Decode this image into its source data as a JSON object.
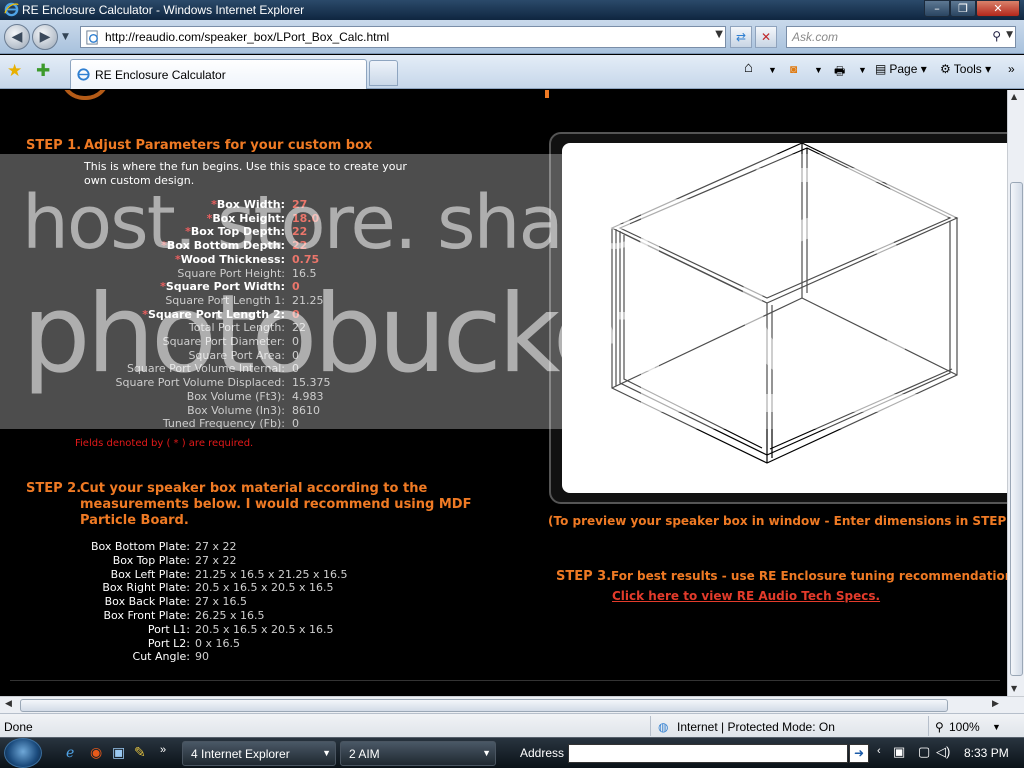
{
  "window": {
    "title": "RE Enclosure Calculator - Windows Internet Explorer",
    "minimize": "–",
    "maximize": "❐",
    "close": "✕"
  },
  "navigation": {
    "url": "http://reaudio.com/speaker_box/LPort_Box_Calc.html",
    "search_placeholder": "Ask.com"
  },
  "tabs": [
    {
      "label": "RE Enclosure Calculator"
    }
  ],
  "commands": {
    "page": "Page",
    "tools": "Tools"
  },
  "step1": {
    "number": "STEP 1.",
    "heading": "Adjust Parameters for your custom box",
    "intro_line1": "This is where the fun begins.  Use this space to create your",
    "intro_line2": "own custom design.",
    "params": [
      {
        "label": "Box Width:",
        "value": "27",
        "required": true
      },
      {
        "label": "Box Height:",
        "value": "18.0",
        "required": true
      },
      {
        "label": "Box Top Depth:",
        "value": "22",
        "required": true
      },
      {
        "label": "Box Bottom Depth:",
        "value": "22",
        "required": true
      },
      {
        "label": "Wood Thickness:",
        "value": "0.75",
        "required": true
      },
      {
        "label": "Square Port Height:",
        "value": "16.5",
        "required": false
      },
      {
        "label": "Square Port Width:",
        "value": "0",
        "required": true
      },
      {
        "label": "Square Port Length 1:",
        "value": "21.25",
        "required": false
      },
      {
        "label": "Square Port Length 2:",
        "value": "0",
        "required": true
      },
      {
        "label": "Total Port Length:",
        "value": "22",
        "required": false
      },
      {
        "label": "Square Port Diameter:",
        "value": "0",
        "required": false
      },
      {
        "label": "Square Port Area:",
        "value": "0",
        "required": false
      },
      {
        "label": "Square Port Volume Internal:",
        "value": "0",
        "required": false
      },
      {
        "label": "Square Port Volume Displaced:",
        "value": "15.375",
        "required": false
      },
      {
        "label": "Box Volume (Ft3):",
        "value": "4.983",
        "required": false
      },
      {
        "label": "Box Volume (In3):",
        "value": "8610",
        "required": false
      },
      {
        "label": "Tuned Frequency (Fb):",
        "value": "0",
        "required": false
      }
    ],
    "required_note": "Fields denoted by ( * ) are required."
  },
  "step2": {
    "number": "STEP 2.",
    "heading_line1": "Cut your speaker box material according to the",
    "heading_line2": "measurements below.  I would recommend using MDF",
    "heading_line3": "Particle Board.",
    "cuts": [
      {
        "label": "Box Bottom Plate:",
        "value": "27 x 22"
      },
      {
        "label": "Box Top Plate:",
        "value": "27 x 22"
      },
      {
        "label": "Box Left Plate:",
        "value": "21.25 x 16.5 x 21.25 x 16.5"
      },
      {
        "label": "Box Right Plate:",
        "value": "20.5 x 16.5 x 20.5 x 16.5"
      },
      {
        "label": "Box Back Plate:",
        "value": "27 x 16.5"
      },
      {
        "label": "Box Front Plate:",
        "value": "26.25 x 16.5"
      },
      {
        "label": "Port L1:",
        "value": "20.5 x 16.5 x 20.5 x 16.5"
      },
      {
        "label": "Port L2:",
        "value": "0 x 16.5"
      },
      {
        "label": "Cut Angle:",
        "value": "90"
      }
    ]
  },
  "preview": {
    "caption": "(To preview your speaker box in window - Enter dimensions in STEP"
  },
  "step3": {
    "number": "STEP 3.",
    "heading": "For best results - use RE Enclosure tuning recommendations",
    "link": "Click here to view RE Audio Tech Specs."
  },
  "watermark": {
    "line1": "host. store. share.",
    "line2": "photobucket"
  },
  "status": {
    "text": "Done",
    "zone": "Internet | Protected Mode: On",
    "zoom": "100%"
  },
  "taskbar": {
    "ie_group": "4 Internet Explorer",
    "aim_group": "2 AIM",
    "address_label": "Address",
    "time": "8:33 PM"
  },
  "colors": {
    "accent_orange": "#ef7a24",
    "required_red": "#e21a1a",
    "page_bg": "#000000"
  }
}
